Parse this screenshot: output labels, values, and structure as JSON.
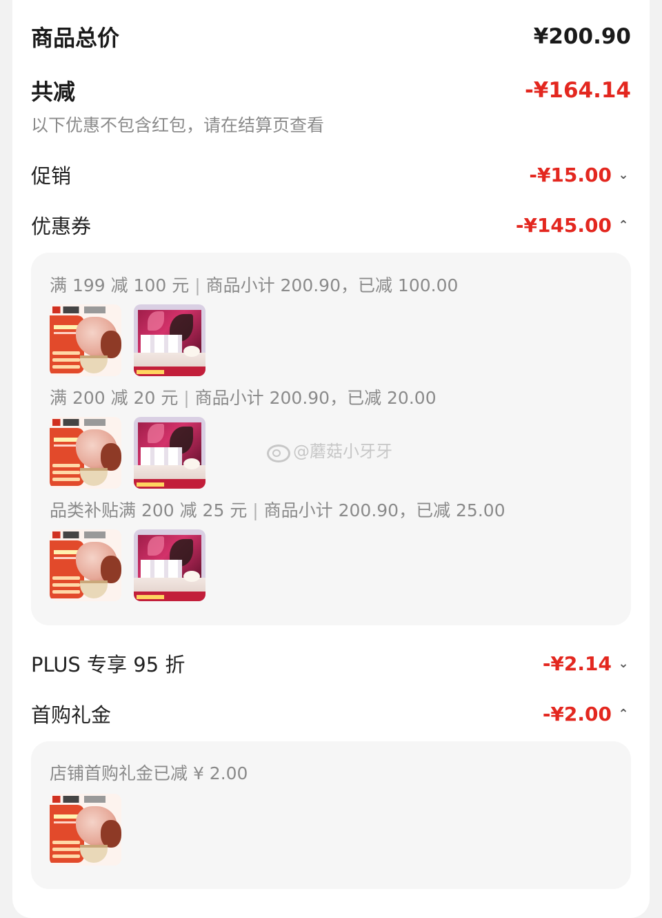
{
  "summary": {
    "total_label": "商品总价",
    "total_value": "¥200.90",
    "discount_label": "共减",
    "discount_value": "-¥164.14",
    "discount_note": "以下优惠不包含红包，请在结算页查看"
  },
  "rows": {
    "promo": {
      "label": "促销",
      "value": "-¥15.00",
      "icon": "chevron-down-icon"
    },
    "coupon": {
      "label": "优惠券",
      "value": "-¥145.00",
      "icon": "chevron-up-icon"
    },
    "plus": {
      "label": "PLUS 专享 95 折",
      "value": "-¥2.14",
      "icon": "chevron-down-icon"
    },
    "first_gift": {
      "label": "首购礼金",
      "value": "-¥2.00",
      "icon": "chevron-up-icon"
    }
  },
  "coupons": [
    {
      "name": "满 199 减 100 元",
      "detail": "商品小计 200.90，已减 100.00"
    },
    {
      "name": "满 200 减 20 元",
      "detail": "商品小计 200.90，已减 20.00"
    },
    {
      "name": "品类补贴满 200 减 25 元",
      "detail": "商品小计 200.90，已减 25.00"
    }
  ],
  "gift_detail": "店铺首购礼金已减 ¥ 2.00",
  "watermark": "@蘑菇小牙牙",
  "colors": {
    "accent_red": "#e3271f",
    "panel_bg": "#f6f6f6",
    "muted_text": "#8a8a8a"
  }
}
